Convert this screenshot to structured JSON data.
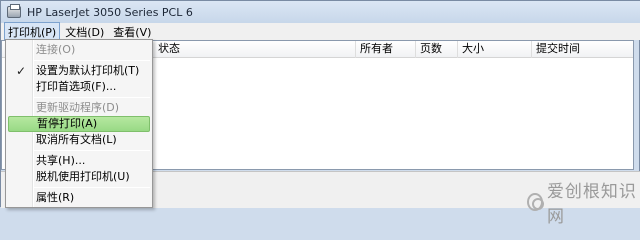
{
  "window": {
    "title": "HP LaserJet 3050 Series PCL 6",
    "icon": "printer-icon"
  },
  "menubar": {
    "items": [
      "打印机(P)",
      "文档(D)",
      "查看(V)"
    ],
    "active_index": 0
  },
  "list": {
    "columns": [
      "状态",
      "所有者",
      "页数",
      "大小",
      "提交时间"
    ]
  },
  "printer_menu": {
    "items": [
      {
        "label": "连接(O)",
        "disabled": true
      },
      {
        "label": "设置为默认打印机(T)",
        "checked": true
      },
      {
        "label": "打印首选项(F)..."
      },
      {
        "label": "更新驱动程序(D)",
        "disabled": true
      },
      {
        "label": "暂停打印(A)",
        "highlighted": true
      },
      {
        "label": "取消所有文档(L)"
      },
      {
        "label": "共享(H)..."
      },
      {
        "label": "脱机使用打印机(U)"
      },
      {
        "label": "属性(R)"
      }
    ],
    "check_glyph": "✓",
    "highlight_color": "#a8e192"
  },
  "watermark": {
    "text": "爱创根知识网"
  }
}
